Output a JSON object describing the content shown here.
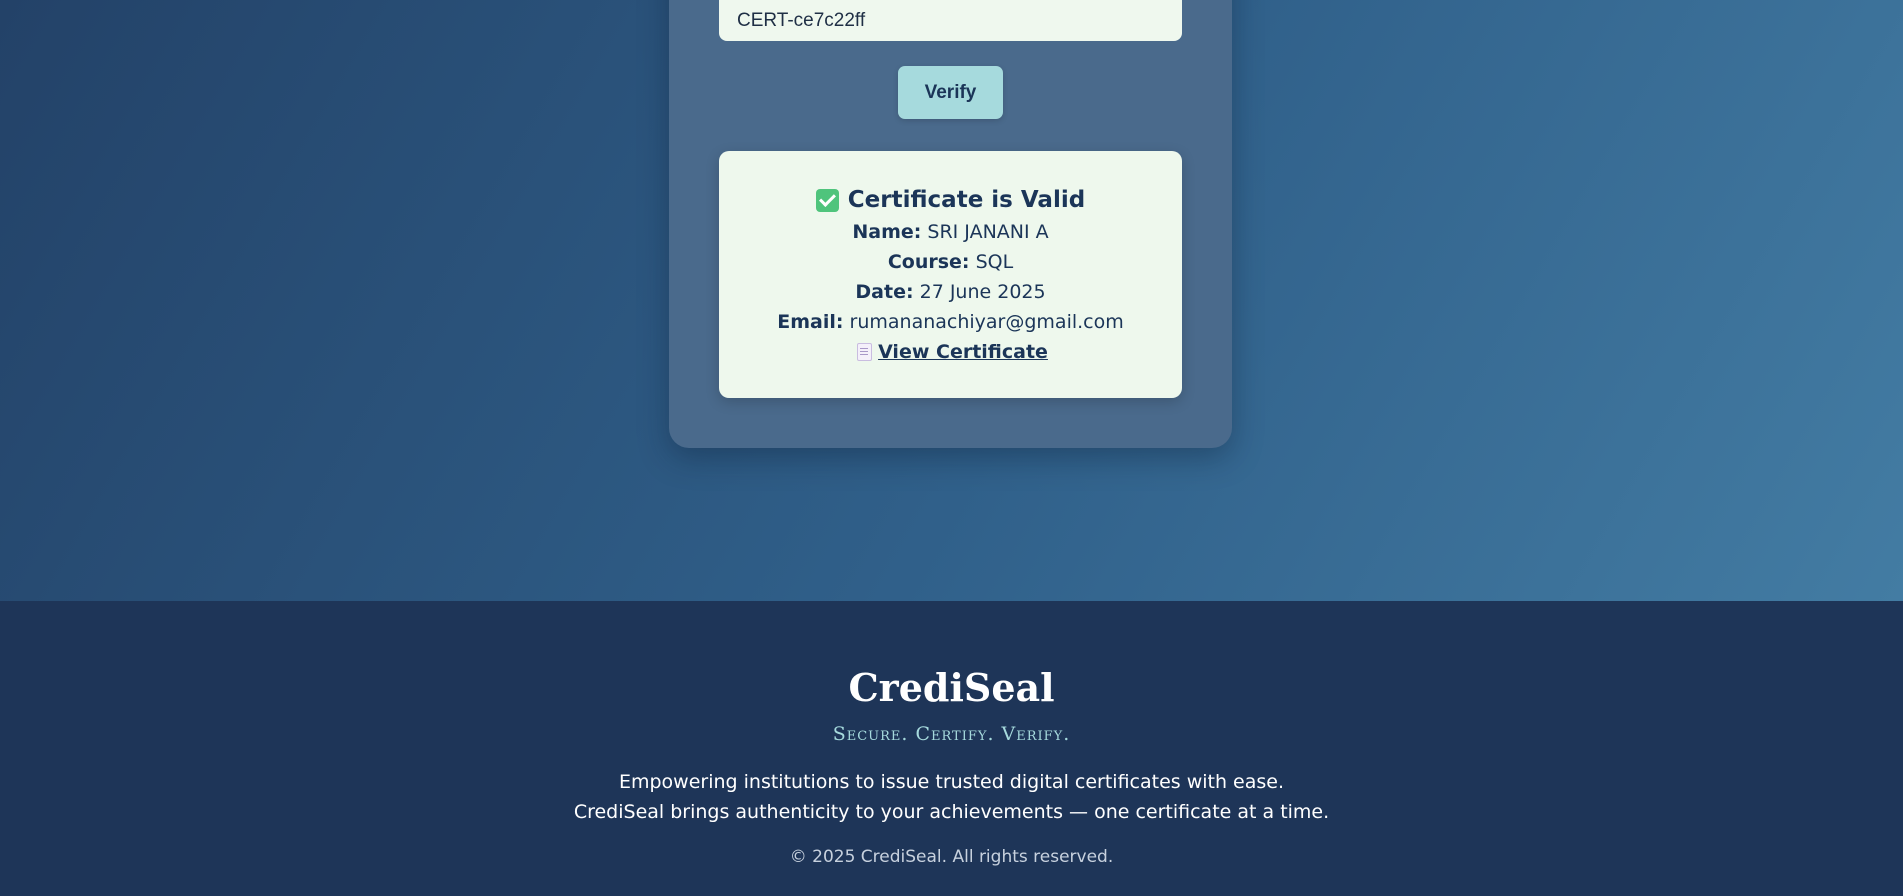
{
  "verify_form": {
    "certificate_id_value": "CERT-ce7c22ff",
    "verify_label": "Verify"
  },
  "result": {
    "title": "Certificate is Valid",
    "status_icon": "check-icon",
    "status_color": "#4fc47c",
    "name_label": "Name:",
    "name_value": "SRI JANANI A",
    "course_label": "Course:",
    "course_value": "SQL",
    "date_label": "Date:",
    "date_value": "27 June 2025",
    "email_label": "Email:",
    "email_value": "rumananachiyar@gmail.com",
    "view_link_icon": "document-icon",
    "view_link_label": "View Certificate"
  },
  "footer": {
    "brand": "CrediSeal",
    "tagline": "Secure. Certify. Verify.",
    "description_line1": "Empowering institutions to issue trusted digital certificates with ease.",
    "description_line2": "CrediSeal brings authenticity to your achievements — one certificate at a time.",
    "copyright": "© 2025 CrediSeal. All rights reserved."
  },
  "colors": {
    "accent": "#a6dadd",
    "card_background": "#eef8ed",
    "footer_background": "#1e3558",
    "text_dark": "#1b3558"
  }
}
